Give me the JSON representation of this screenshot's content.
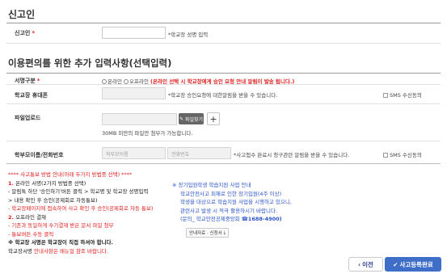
{
  "section1": {
    "title": "신고인",
    "reporter_label": "신고인",
    "required_mark": "*",
    "reporter_hint": "*학교장 성명 입력"
  },
  "section2": {
    "title": "이용편의를 위한 추가 입력사항(선택입력)",
    "sign": {
      "label": "서명구분",
      "required_mark": "*",
      "option_online": "온라인",
      "option_offline": "오프라인",
      "note": "(온라인 선택 시 학교장에게 승인 요청 안내 알림이 발송 됩니다.)"
    },
    "principal_phone": {
      "label": "학교장 휴대폰",
      "hint": "*학교장 승인요청에 대한알림을 받을 수 있습니다.",
      "sms_label": "SMS 수신동의"
    },
    "file_upload": {
      "label": "파일업로드",
      "find_button": "파일찾기",
      "plus": "+",
      "hint": "30MB 미만의 파일만 첨부가 가능합니다."
    },
    "parent": {
      "label": "학부모이름/전화번호",
      "name_placeholder": "학부모이름",
      "phone_placeholder": "전화번호",
      "hint": "*사고접수 완료시 청구관련 알림을 받을 수 있습니다.",
      "sms_label": "SMS 수신동의"
    }
  },
  "guide": {
    "title": "**** 사고통보 방법 안내(아래 두가지 방법중 선택) ****",
    "l1_num": "1.",
    "l1": "온라인 서명(2가지 방법중 선택)",
    "l2": "- 알림톡 하단 '승인하기'버튼 클릭 > 학교명 및 학교장 성명입력",
    "l3": "> 내용 확인 후 승인(공제회로 자동통보)",
    "l4": "- 학교장페이지에 접속하여 사고 확인 후 승인(공제회로 자동 통보)",
    "l5_num": "2.",
    "l5": "오프라인 결재",
    "l6": "- 기존과 동일하게 수기결재 받은 문서 파일 첨부",
    "l7": "- 통보버튼 수동 클릭",
    "l8": "※ 학교장 서명은 학교장이 직접 하셔야 합니다.",
    "l9a": "학교장서명",
    "l9b": "안내사항은 매뉴얼 참조 바랍니다."
  },
  "notice": {
    "l1": "※ 장기입원학생 학습지원 사업 안내",
    "l2": "학교안전사고 피해로 인한 장기입원(4주 이상)",
    "l3": "학생을 대상으로 학습지원 사업을 시행하고 있으니,",
    "l4": "관련사고 발생 시 적극 활용하시기 바랍니다.",
    "l5a": "(문의_ 학교안전공제중앙회 ",
    "l5b": "☎1688-4900)",
    "download": "안내자료 · 신청서"
  },
  "footer": {
    "prev": "이전",
    "submit": "사고등록완료"
  }
}
